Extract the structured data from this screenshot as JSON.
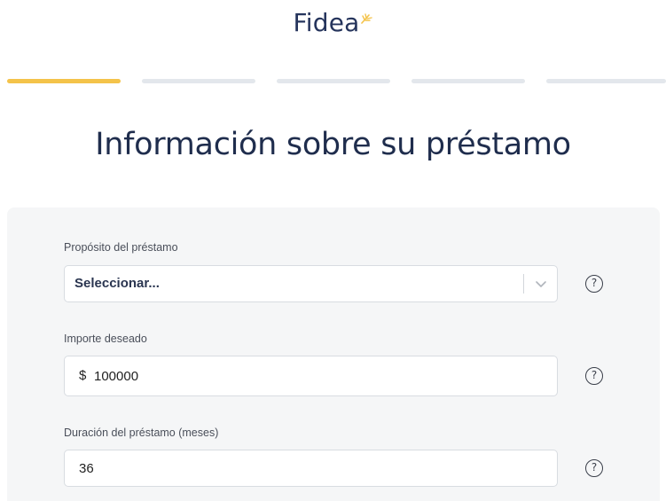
{
  "brand": {
    "name": "Fidea",
    "accent": "#f4c34a",
    "primary": "#25345c"
  },
  "progress": {
    "total_steps": 5,
    "current_step": 1
  },
  "page": {
    "title": "Información sobre su préstamo"
  },
  "form": {
    "purpose": {
      "label": "Propósito del préstamo",
      "value": "Seleccionar...",
      "icon": "chevron-down-icon",
      "help_icon": "?"
    },
    "amount": {
      "label": "Importe deseado",
      "currency": "$",
      "value": "100000",
      "help_icon": "?"
    },
    "duration": {
      "label": "Duración del préstamo (meses)",
      "value": "36",
      "help_icon": "?"
    }
  }
}
